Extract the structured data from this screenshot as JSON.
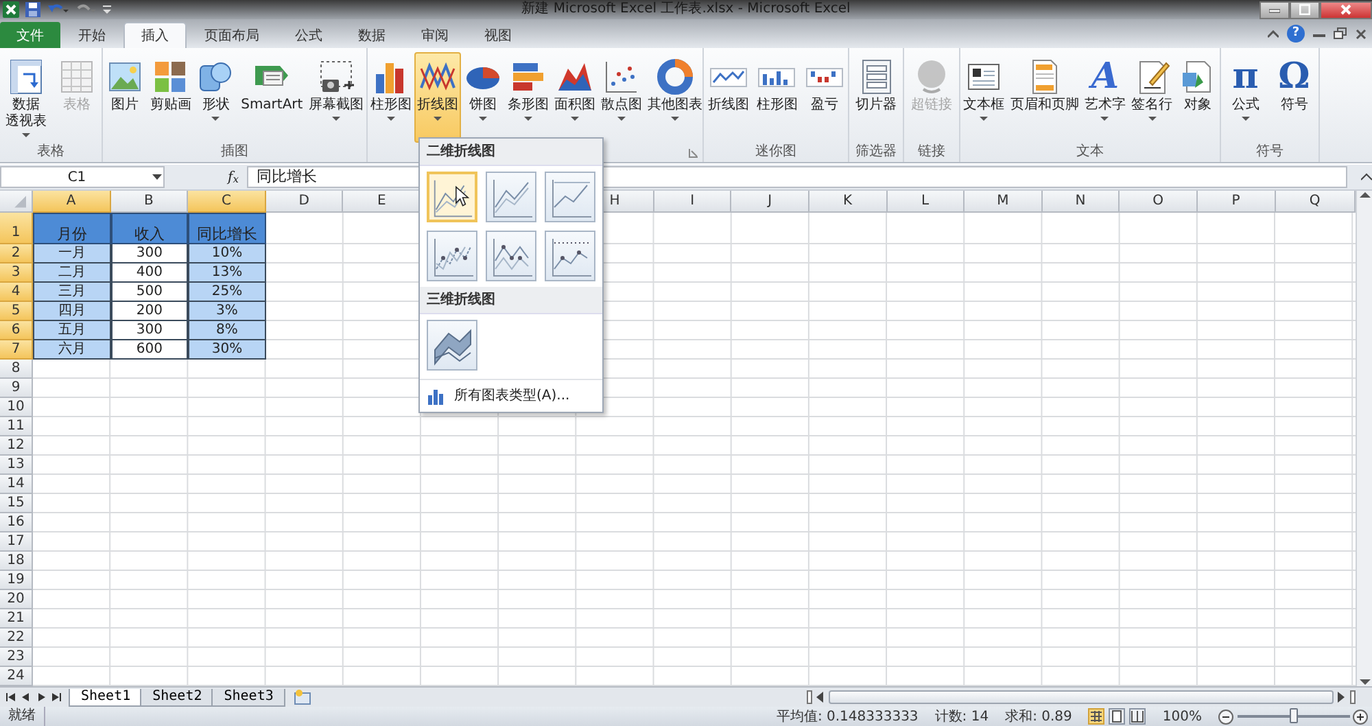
{
  "window": {
    "title": "新建 Microsoft Excel 工作表.xlsx - Microsoft Excel",
    "help_glyph": "?"
  },
  "tabs": [
    {
      "label": "文件",
      "kind": "file",
      "selected": false
    },
    {
      "label": "开始",
      "kind": "tab",
      "selected": false
    },
    {
      "label": "插入",
      "kind": "tab",
      "selected": true
    },
    {
      "label": "页面布局",
      "kind": "tab",
      "selected": false
    },
    {
      "label": "公式",
      "kind": "tab",
      "selected": false
    },
    {
      "label": "数据",
      "kind": "tab",
      "selected": false
    },
    {
      "label": "审阅",
      "kind": "tab",
      "selected": false
    },
    {
      "label": "视图",
      "kind": "tab",
      "selected": false
    }
  ],
  "ribbon": {
    "groups": [
      {
        "label": "表格",
        "items": [
          {
            "lines": [
              "数据",
              "透视表"
            ],
            "dropdown": true,
            "disabled": false,
            "selected": false
          },
          {
            "lines": [
              "表格"
            ],
            "dropdown": false,
            "disabled": true,
            "selected": false
          }
        ]
      },
      {
        "label": "插图",
        "items": [
          {
            "lines": [
              "图片"
            ],
            "dropdown": false,
            "disabled": false,
            "selected": false
          },
          {
            "lines": [
              "剪贴画"
            ],
            "dropdown": false,
            "disabled": false,
            "selected": false
          },
          {
            "lines": [
              "形状"
            ],
            "dropdown": true,
            "disabled": false,
            "selected": false
          },
          {
            "lines": [
              "SmartArt"
            ],
            "dropdown": false,
            "disabled": false,
            "selected": false
          },
          {
            "lines": [
              "屏幕截图"
            ],
            "dropdown": true,
            "disabled": false,
            "selected": false
          }
        ]
      },
      {
        "items": [
          {
            "lines": [
              "柱形图"
            ],
            "dropdown": true,
            "disabled": false,
            "selected": false
          },
          {
            "lines": [
              "折线图"
            ],
            "dropdown": true,
            "disabled": false,
            "selected": true
          },
          {
            "lines": [
              "饼图"
            ],
            "dropdown": true,
            "disabled": false,
            "selected": false
          },
          {
            "lines": [
              "条形图"
            ],
            "dropdown": true,
            "disabled": false,
            "selected": false
          },
          {
            "lines": [
              "面积图"
            ],
            "dropdown": true,
            "disabled": false,
            "selected": false
          },
          {
            "lines": [
              "散点图"
            ],
            "dropdown": true,
            "disabled": false,
            "selected": false
          },
          {
            "lines": [
              "其他图表"
            ],
            "dropdown": true,
            "disabled": false,
            "selected": false
          }
        ]
      },
      {
        "label": "迷你图",
        "items": [
          {
            "lines": [
              "折线图"
            ],
            "dropdown": false,
            "disabled": false,
            "selected": false
          },
          {
            "lines": [
              "柱形图"
            ],
            "dropdown": false,
            "disabled": false,
            "selected": false
          },
          {
            "lines": [
              "盈亏"
            ],
            "dropdown": false,
            "disabled": false,
            "selected": false
          }
        ]
      },
      {
        "label": "筛选器",
        "items": [
          {
            "lines": [
              "切片器"
            ],
            "dropdown": false,
            "disabled": false,
            "selected": false
          }
        ]
      },
      {
        "label": "链接",
        "items": [
          {
            "lines": [
              "超链接"
            ],
            "dropdown": false,
            "disabled": true,
            "selected": false
          }
        ]
      },
      {
        "label": "文本",
        "items": [
          {
            "lines": [
              "文本框"
            ],
            "dropdown": true,
            "disabled": false,
            "selected": false
          },
          {
            "lines": [
              "页眉和页脚"
            ],
            "dropdown": false,
            "disabled": false,
            "selected": false
          },
          {
            "glyph": "A",
            "lines": [
              "艺术字"
            ],
            "dropdown": true,
            "disabled": false,
            "selected": false
          },
          {
            "lines": [
              "签名行"
            ],
            "dropdown": true,
            "disabled": false,
            "selected": false
          },
          {
            "lines": [
              "对象"
            ],
            "dropdown": false,
            "disabled": false,
            "selected": false
          }
        ]
      },
      {
        "label": "符号",
        "items": [
          {
            "glyph": "π",
            "lines": [
              "公式"
            ],
            "dropdown": true,
            "disabled": false,
            "selected": false
          },
          {
            "glyph": "Ω",
            "lines": [
              "符号"
            ],
            "dropdown": false,
            "disabled": false,
            "selected": false
          }
        ]
      }
    ]
  },
  "formula_bar": {
    "name_box": "C1",
    "fx_label": "f$_{x}$",
    "value": "同比增长"
  },
  "table": {
    "columns": [
      {
        "label": "A",
        "selected": true
      },
      {
        "label": "B",
        "selected": false
      },
      {
        "label": "C",
        "selected": true
      },
      {
        "label": "D",
        "selected": false
      },
      {
        "label": "E",
        "selected": false
      },
      {
        "label": "H",
        "selected": false
      },
      {
        "label": "I",
        "selected": false
      },
      {
        "label": "J",
        "selected": false
      },
      {
        "label": "K",
        "selected": false
      },
      {
        "label": "L",
        "selected": false
      },
      {
        "label": "M",
        "selected": false
      },
      {
        "label": "N",
        "selected": false
      },
      {
        "label": "O",
        "selected": false
      },
      {
        "label": "P",
        "selected": false
      },
      {
        "label": "Q",
        "selected": false
      }
    ],
    "rows": [
      {
        "label": "1",
        "selected": true,
        "kind": "header",
        "cells": [
          "月份",
          "收入",
          "同比增长"
        ]
      },
      {
        "label": "2",
        "selected": true,
        "kind": "data",
        "cells": [
          "一月",
          "300",
          "10%"
        ]
      },
      {
        "label": "3",
        "selected": true,
        "kind": "data",
        "cells": [
          "二月",
          "400",
          "13%"
        ]
      },
      {
        "label": "4",
        "selected": true,
        "kind": "data",
        "cells": [
          "三月",
          "500",
          "25%"
        ]
      },
      {
        "label": "5",
        "selected": true,
        "kind": "data",
        "cells": [
          "四月",
          "200",
          "3%"
        ]
      },
      {
        "label": "6",
        "selected": true,
        "kind": "data",
        "cells": [
          "五月",
          "300",
          "8%"
        ]
      },
      {
        "label": "7",
        "selected": true,
        "kind": "data",
        "cells": [
          "六月",
          "600",
          "30%"
        ]
      },
      {
        "label": "8",
        "selected": false
      },
      {
        "label": "9",
        "selected": false
      },
      {
        "label": "10",
        "selected": false
      },
      {
        "label": "11",
        "selected": false
      },
      {
        "label": "12",
        "selected": false
      },
      {
        "label": "13",
        "selected": false
      },
      {
        "label": "14",
        "selected": false
      },
      {
        "label": "15",
        "selected": false
      },
      {
        "label": "16",
        "selected": false
      },
      {
        "label": "17",
        "selected": false
      },
      {
        "label": "18",
        "selected": false
      },
      {
        "label": "19",
        "selected": false
      },
      {
        "label": "20",
        "selected": false
      },
      {
        "label": "21",
        "selected": false
      },
      {
        "label": "22",
        "selected": false
      },
      {
        "label": "23",
        "selected": false
      },
      {
        "label": "24",
        "selected": false
      }
    ]
  },
  "chart_menu": {
    "sections": [
      {
        "title": "二维折线图",
        "items": [
          {
            "highlighted": true
          },
          {
            "highlighted": false
          },
          {
            "highlighted": false
          },
          {
            "highlighted": false
          },
          {
            "highlighted": false
          },
          {
            "highlighted": false
          }
        ]
      },
      {
        "title": "三维折线图",
        "items": [
          {
            "highlighted": false
          }
        ]
      }
    ],
    "footer": "所有图表类型(A)..."
  },
  "sheet_tabs": [
    {
      "label": "Sheet1",
      "selected": true
    },
    {
      "label": "Sheet2",
      "selected": false
    },
    {
      "label": "Sheet3",
      "selected": false
    }
  ],
  "status_bar": {
    "mode": "就绪",
    "average": "平均值: 0.148333333",
    "count": "计数: 14",
    "sum": "求和: 0.89",
    "views": [
      {
        "selected": true
      },
      {
        "selected": false
      },
      {
        "selected": false
      }
    ],
    "zoom": "100%",
    "zoom_slider": {
      "level": 0.5
    }
  }
}
